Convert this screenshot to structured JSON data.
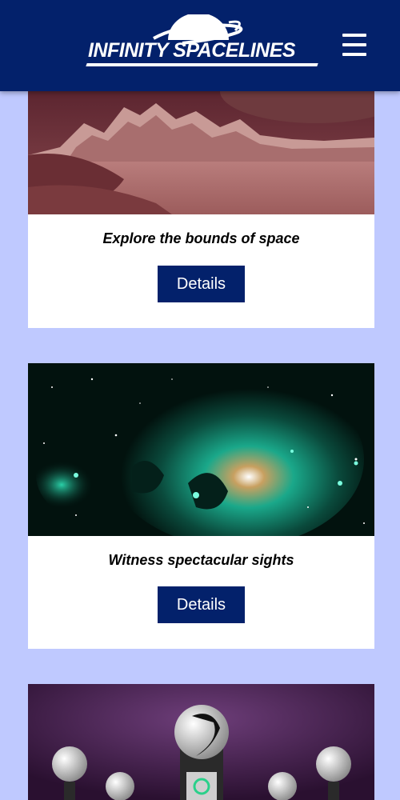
{
  "header": {
    "logo_text": "INFINITY SPACELINES",
    "menu_icon": "hamburger-menu-icon",
    "background": "#03216b"
  },
  "page": {
    "background": "#bfc9ff"
  },
  "cards": [
    {
      "title": "Explore the bounds of space",
      "button_label": "Details",
      "image": "red-planet-landscape"
    },
    {
      "title": "Witness spectacular sights",
      "button_label": "Details",
      "image": "green-nebula"
    },
    {
      "title": "",
      "button_label": "",
      "image": "robot-theater"
    }
  ],
  "accent": "#03216b"
}
